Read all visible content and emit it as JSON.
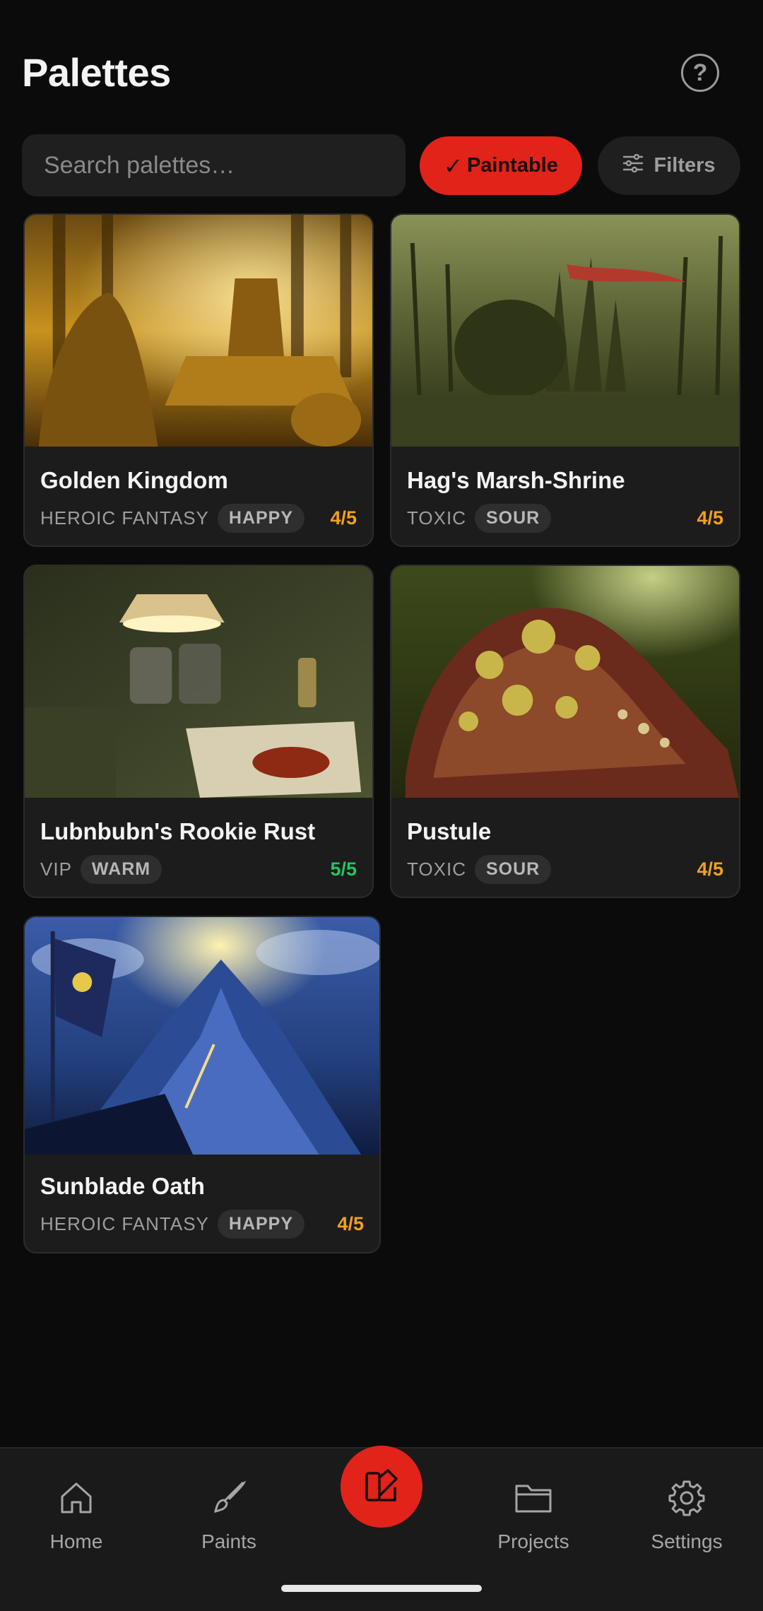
{
  "header": {
    "title": "Palettes",
    "help_icon": "help-circle-icon"
  },
  "search": {
    "placeholder": "Search palettes…",
    "value": ""
  },
  "chips": {
    "paintable": {
      "check": "✓",
      "label": "Paintable",
      "active": true,
      "color": "#e2231a"
    },
    "filters": {
      "label": "Filters",
      "icon": "sliders-icon"
    }
  },
  "palettes": [
    {
      "name": "Golden Kingdom",
      "category": "HEROIC FANTASY",
      "tag": "HAPPY",
      "score": "4/5",
      "score_color": "#f0a020",
      "art": "golden throne room"
    },
    {
      "name": "Hag's Marsh-Shrine",
      "category": "TOXIC",
      "tag": "SOUR",
      "score": "4/5",
      "score_color": "#f0a020",
      "art": "swamp shrine with red banner"
    },
    {
      "name": "Lubnbubn's Rookie Rust",
      "category": "VIP",
      "tag": "WARM",
      "score": "5/5",
      "score_color": "#22c55e",
      "art": "hobby painting desk"
    },
    {
      "name": "Pustule",
      "category": "TOXIC",
      "tag": "SOUR",
      "score": "4/5",
      "score_color": "#f0a020",
      "art": "fleshy creature mound"
    },
    {
      "name": "Sunblade Oath",
      "category": "HEROIC FANTASY",
      "tag": "HAPPY",
      "score": "4/5",
      "score_color": "#f0a020",
      "art": "blue mountain citadel"
    }
  ],
  "nav": {
    "items": [
      {
        "label": "Home",
        "icon": "home-icon"
      },
      {
        "label": "Paints",
        "icon": "brush-icon"
      },
      {
        "label": "Projects",
        "icon": "folder-icon"
      },
      {
        "label": "Settings",
        "icon": "gear-icon"
      }
    ],
    "fab_icon": "palette-swatch-icon",
    "accent": "#e2231a"
  }
}
